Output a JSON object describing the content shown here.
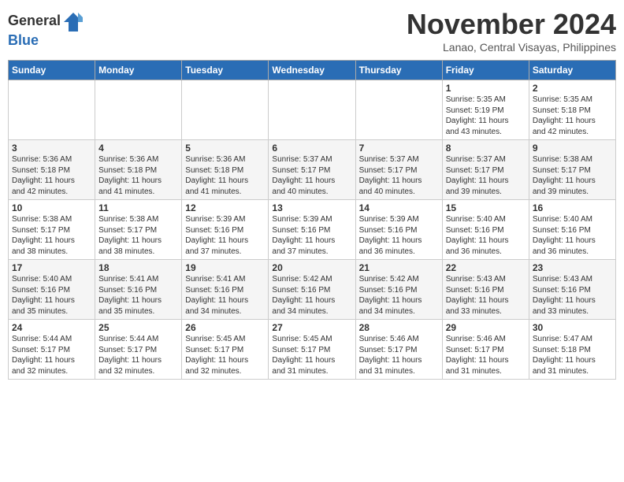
{
  "logo": {
    "general": "General",
    "blue": "Blue"
  },
  "title": "November 2024",
  "location": "Lanao, Central Visayas, Philippines",
  "headers": [
    "Sunday",
    "Monday",
    "Tuesday",
    "Wednesday",
    "Thursday",
    "Friday",
    "Saturday"
  ],
  "weeks": [
    [
      {
        "day": "",
        "info": ""
      },
      {
        "day": "",
        "info": ""
      },
      {
        "day": "",
        "info": ""
      },
      {
        "day": "",
        "info": ""
      },
      {
        "day": "",
        "info": ""
      },
      {
        "day": "1",
        "info": "Sunrise: 5:35 AM\nSunset: 5:19 PM\nDaylight: 11 hours\nand 43 minutes."
      },
      {
        "day": "2",
        "info": "Sunrise: 5:35 AM\nSunset: 5:18 PM\nDaylight: 11 hours\nand 42 minutes."
      }
    ],
    [
      {
        "day": "3",
        "info": "Sunrise: 5:36 AM\nSunset: 5:18 PM\nDaylight: 11 hours\nand 42 minutes."
      },
      {
        "day": "4",
        "info": "Sunrise: 5:36 AM\nSunset: 5:18 PM\nDaylight: 11 hours\nand 41 minutes."
      },
      {
        "day": "5",
        "info": "Sunrise: 5:36 AM\nSunset: 5:18 PM\nDaylight: 11 hours\nand 41 minutes."
      },
      {
        "day": "6",
        "info": "Sunrise: 5:37 AM\nSunset: 5:17 PM\nDaylight: 11 hours\nand 40 minutes."
      },
      {
        "day": "7",
        "info": "Sunrise: 5:37 AM\nSunset: 5:17 PM\nDaylight: 11 hours\nand 40 minutes."
      },
      {
        "day": "8",
        "info": "Sunrise: 5:37 AM\nSunset: 5:17 PM\nDaylight: 11 hours\nand 39 minutes."
      },
      {
        "day": "9",
        "info": "Sunrise: 5:38 AM\nSunset: 5:17 PM\nDaylight: 11 hours\nand 39 minutes."
      }
    ],
    [
      {
        "day": "10",
        "info": "Sunrise: 5:38 AM\nSunset: 5:17 PM\nDaylight: 11 hours\nand 38 minutes."
      },
      {
        "day": "11",
        "info": "Sunrise: 5:38 AM\nSunset: 5:17 PM\nDaylight: 11 hours\nand 38 minutes."
      },
      {
        "day": "12",
        "info": "Sunrise: 5:39 AM\nSunset: 5:16 PM\nDaylight: 11 hours\nand 37 minutes."
      },
      {
        "day": "13",
        "info": "Sunrise: 5:39 AM\nSunset: 5:16 PM\nDaylight: 11 hours\nand 37 minutes."
      },
      {
        "day": "14",
        "info": "Sunrise: 5:39 AM\nSunset: 5:16 PM\nDaylight: 11 hours\nand 36 minutes."
      },
      {
        "day": "15",
        "info": "Sunrise: 5:40 AM\nSunset: 5:16 PM\nDaylight: 11 hours\nand 36 minutes."
      },
      {
        "day": "16",
        "info": "Sunrise: 5:40 AM\nSunset: 5:16 PM\nDaylight: 11 hours\nand 36 minutes."
      }
    ],
    [
      {
        "day": "17",
        "info": "Sunrise: 5:40 AM\nSunset: 5:16 PM\nDaylight: 11 hours\nand 35 minutes."
      },
      {
        "day": "18",
        "info": "Sunrise: 5:41 AM\nSunset: 5:16 PM\nDaylight: 11 hours\nand 35 minutes."
      },
      {
        "day": "19",
        "info": "Sunrise: 5:41 AM\nSunset: 5:16 PM\nDaylight: 11 hours\nand 34 minutes."
      },
      {
        "day": "20",
        "info": "Sunrise: 5:42 AM\nSunset: 5:16 PM\nDaylight: 11 hours\nand 34 minutes."
      },
      {
        "day": "21",
        "info": "Sunrise: 5:42 AM\nSunset: 5:16 PM\nDaylight: 11 hours\nand 34 minutes."
      },
      {
        "day": "22",
        "info": "Sunrise: 5:43 AM\nSunset: 5:16 PM\nDaylight: 11 hours\nand 33 minutes."
      },
      {
        "day": "23",
        "info": "Sunrise: 5:43 AM\nSunset: 5:16 PM\nDaylight: 11 hours\nand 33 minutes."
      }
    ],
    [
      {
        "day": "24",
        "info": "Sunrise: 5:44 AM\nSunset: 5:17 PM\nDaylight: 11 hours\nand 32 minutes."
      },
      {
        "day": "25",
        "info": "Sunrise: 5:44 AM\nSunset: 5:17 PM\nDaylight: 11 hours\nand 32 minutes."
      },
      {
        "day": "26",
        "info": "Sunrise: 5:45 AM\nSunset: 5:17 PM\nDaylight: 11 hours\nand 32 minutes."
      },
      {
        "day": "27",
        "info": "Sunrise: 5:45 AM\nSunset: 5:17 PM\nDaylight: 11 hours\nand 31 minutes."
      },
      {
        "day": "28",
        "info": "Sunrise: 5:46 AM\nSunset: 5:17 PM\nDaylight: 11 hours\nand 31 minutes."
      },
      {
        "day": "29",
        "info": "Sunrise: 5:46 AM\nSunset: 5:17 PM\nDaylight: 11 hours\nand 31 minutes."
      },
      {
        "day": "30",
        "info": "Sunrise: 5:47 AM\nSunset: 5:18 PM\nDaylight: 11 hours\nand 31 minutes."
      }
    ]
  ]
}
